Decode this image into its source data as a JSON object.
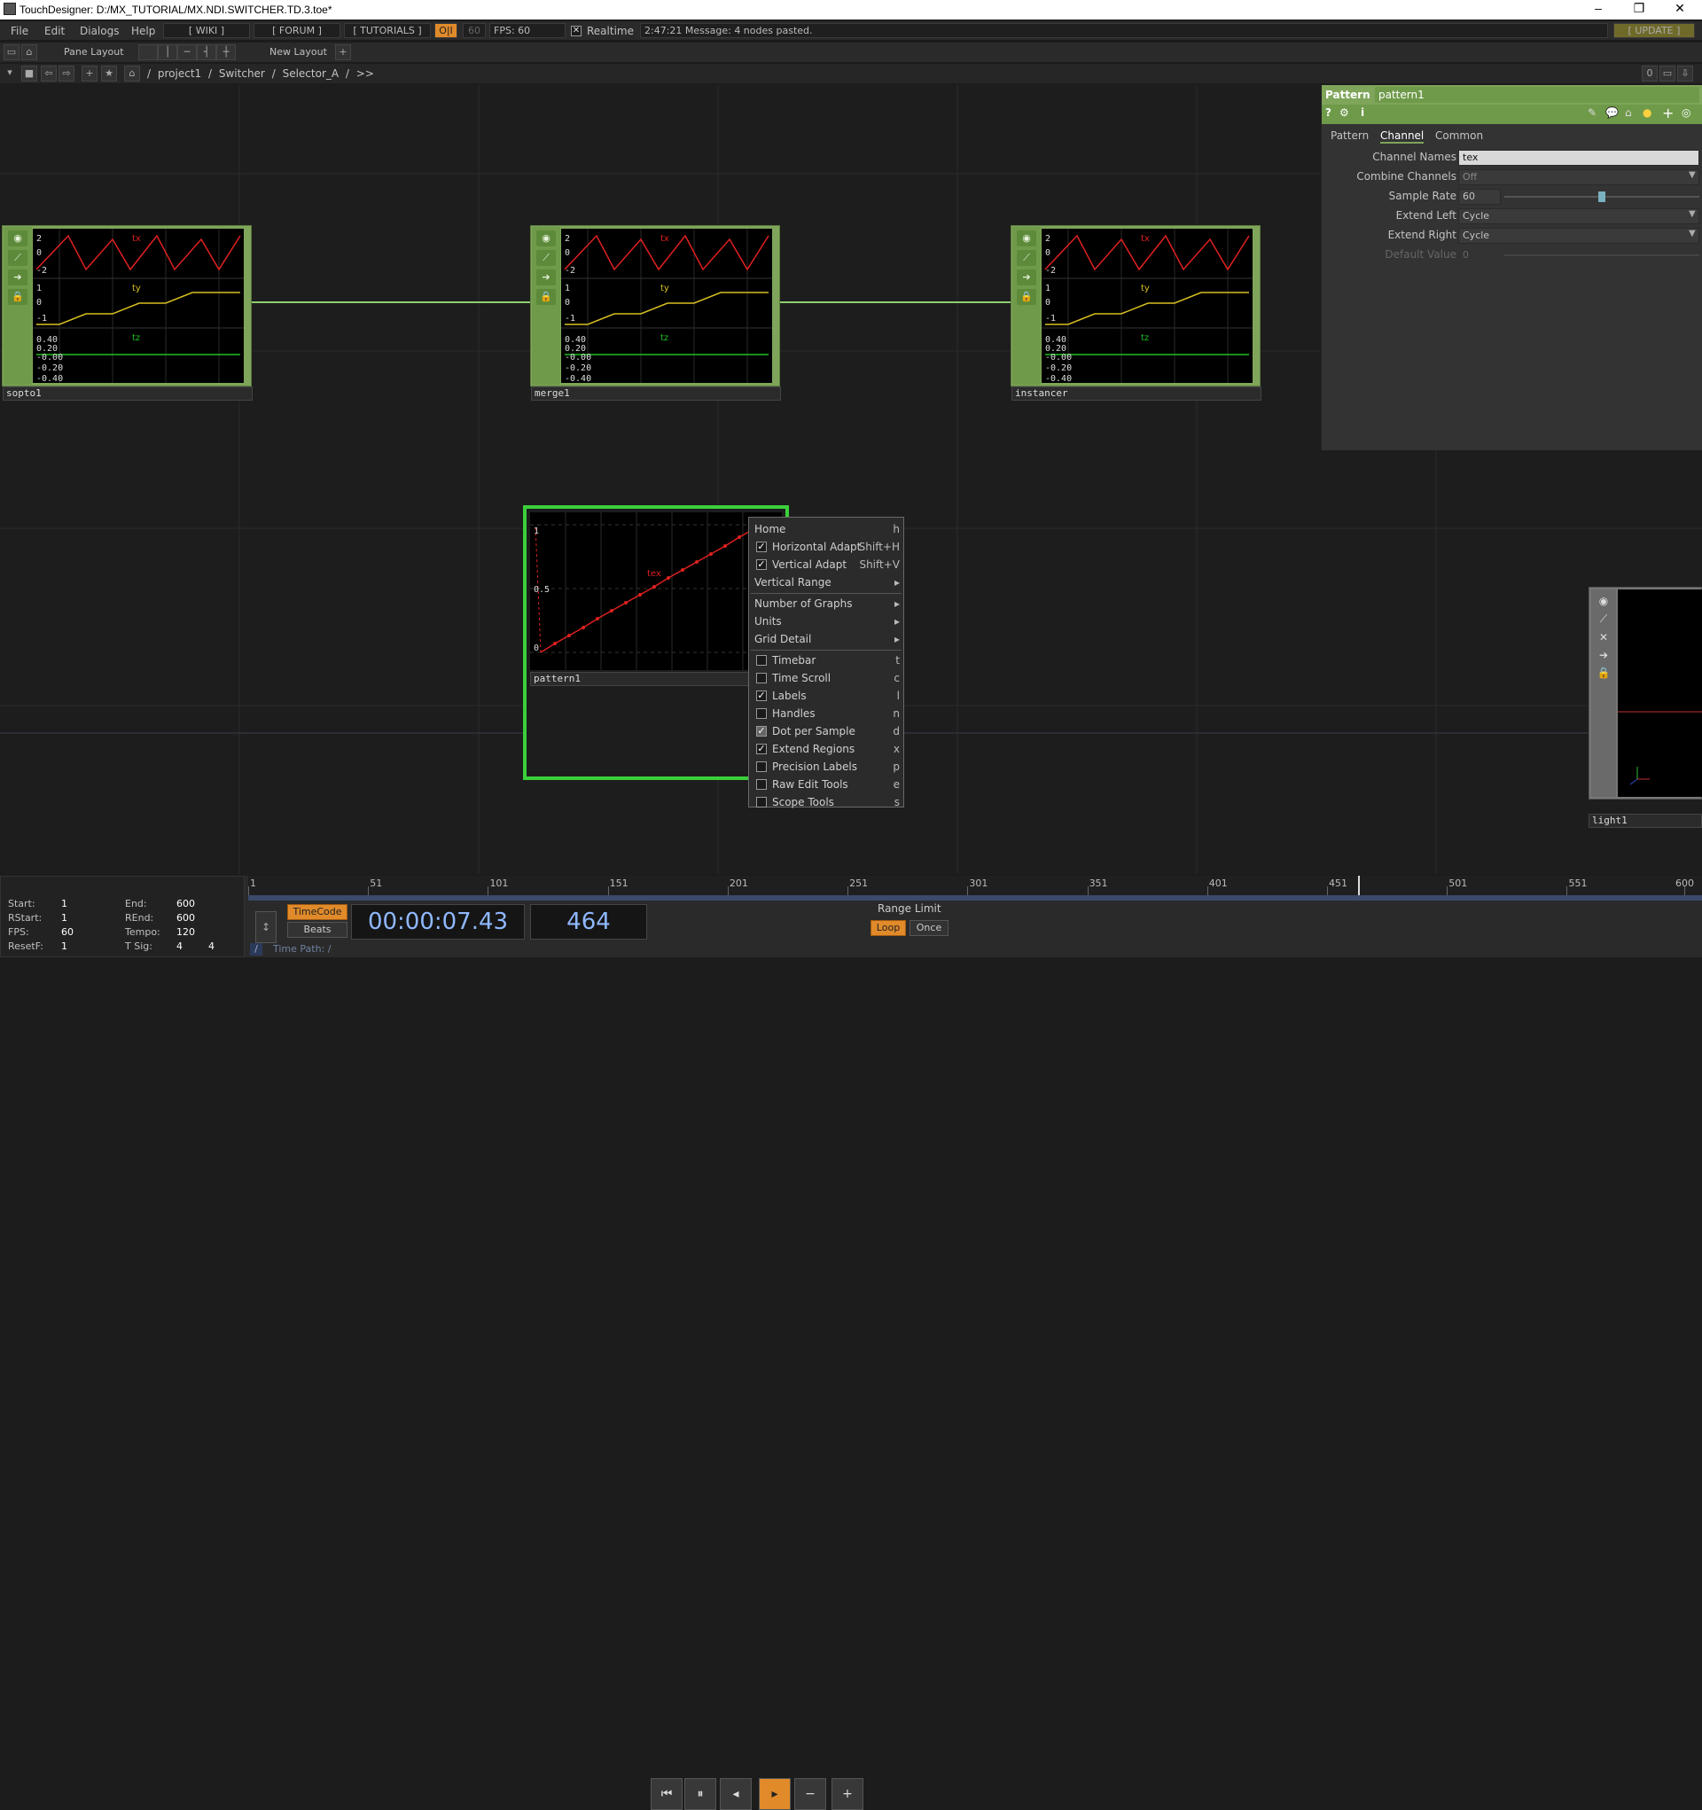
{
  "window": {
    "title": "TouchDesigner: D:/MX_TUTORIAL/MX.NDI.SWITCHER.TD.3.toe*"
  },
  "menu": {
    "file": "File",
    "edit": "Edit",
    "dialogs": "Dialogs",
    "help": "Help",
    "wiki": "[ WIKI ]",
    "forum": "[ FORUM ]",
    "tutorials": "[ TUTORIALS ]",
    "oi": "O|I",
    "fps_set": "60",
    "fps_label": "FPS:  60",
    "realtime": "Realtime",
    "message": "2:47:21 Message: 4 nodes pasted.",
    "update": "[ UPDATE ]"
  },
  "toolbar": {
    "pane_layout": "Pane Layout",
    "new_layout": "New Layout"
  },
  "path": {
    "segments": [
      "/",
      "project1",
      "/",
      "Switcher",
      "/",
      "Selector_A",
      "/",
      ">>"
    ],
    "right_num": "0"
  },
  "nodes": {
    "sopto1": "sopto1",
    "merge1": "merge1",
    "instancer": "instancer",
    "pattern1": "pattern1",
    "light1": "light1",
    "ch_tx": "tx",
    "ch_ty": "ty",
    "ch_tz": "tz",
    "ch_tex": "tex",
    "y_2": "2",
    "y_0": "0",
    "y_m2": "-2",
    "y_1": "1",
    "y_m1": "-1",
    "z_040": "0.40",
    "z_020": "0.20",
    "z_000": "-0.00",
    "z_m020": "-0.20",
    "z_m040": "-0.40",
    "p_1": "1",
    "p_05": "0.5",
    "p_0": "0"
  },
  "params": {
    "op_type": "Pattern",
    "op_name": "pattern1",
    "tabs": [
      "Pattern",
      "Channel",
      "Common"
    ],
    "rows": [
      {
        "label": "Channel Names",
        "value": "tex"
      },
      {
        "label": "Combine Channels",
        "value": "Off"
      },
      {
        "label": "Sample Rate",
        "value": "60"
      },
      {
        "label": "Extend Left",
        "value": "Cycle"
      },
      {
        "label": "Extend Right",
        "value": "Cycle"
      },
      {
        "label": "Default Value",
        "value": "0"
      }
    ]
  },
  "context_menu": {
    "items": [
      {
        "label": "Home",
        "key": "h"
      },
      {
        "label": "Horizontal Adapt",
        "key": "Shift+H",
        "checked": true
      },
      {
        "label": "Vertical Adapt",
        "key": "Shift+V",
        "checked": true
      },
      {
        "label": "Vertical Range",
        "key": "▸"
      },
      {
        "label": "Number of Graphs",
        "key": "▸"
      },
      {
        "label": "Units",
        "key": "▸"
      },
      {
        "label": "Grid Detail",
        "key": "▸"
      },
      {
        "label": "Timebar",
        "key": "t",
        "checked": false
      },
      {
        "label": "Time Scroll",
        "key": "c",
        "checked": false
      },
      {
        "label": "Labels",
        "key": "l",
        "checked": true
      },
      {
        "label": "Handles",
        "key": "n",
        "checked": false
      },
      {
        "label": "Dot per Sample",
        "key": "d",
        "checked": true,
        "disabled": true
      },
      {
        "label": "Extend Regions",
        "key": "x",
        "checked": true
      },
      {
        "label": "Precision Labels",
        "key": "p",
        "checked": false
      },
      {
        "label": "Raw Edit Tools",
        "key": "e",
        "checked": false
      },
      {
        "label": "Scope Tools",
        "key": "s",
        "checked": false
      }
    ]
  },
  "timeline": {
    "ticks": [
      "1",
      "51",
      "101",
      "151",
      "201",
      "251",
      "301",
      "351",
      "401",
      "451",
      "501",
      "551",
      "600"
    ],
    "start_label": "Start:",
    "start": "1",
    "end_label": "End:",
    "end": "600",
    "rstart_label": "RStart:",
    "rstart": "1",
    "rend_label": "REnd:",
    "rend": "600",
    "fps_label": "FPS:",
    "fps": "60",
    "tempo_label": "Tempo:",
    "tempo": "120",
    "resetf_label": "ResetF:",
    "resetf": "1",
    "tsig_label": "T Sig:",
    "tsig_a": "4",
    "tsig_b": "4",
    "timecode_btn": "TimeCode",
    "beats_btn": "Beats",
    "timecode": "00:00:07.43",
    "frame": "464",
    "range_limit": "Range Limit",
    "loop": "Loop",
    "once": "Once",
    "time_path": "Time Path: /",
    "slash": "/",
    "current_frame_fraction": 0.773
  },
  "colors": {
    "node_green": "#7fa55a",
    "tx": "#e02020",
    "ty": "#d8c020",
    "tz": "#20c020",
    "accent": "#e08a2a"
  }
}
